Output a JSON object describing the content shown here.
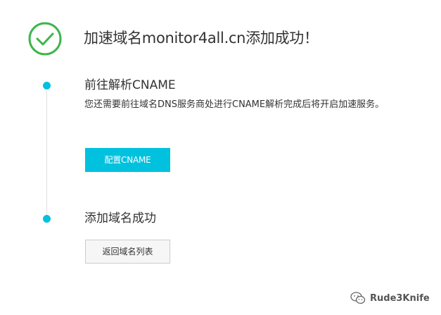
{
  "header": {
    "title": "加速域名monitor4all.cn添加成功！",
    "status_icon": "check-circle-icon",
    "status_color": "#3cb64a"
  },
  "steps": [
    {
      "title": "前往解析CNAME",
      "description": "您还需要前往域名DNS服务商处进行CNAME解析完成后将开启加速服务。",
      "button_label": "配置CNAME"
    },
    {
      "title": "添加域名成功",
      "button_label": "返回域名列表"
    }
  ],
  "colors": {
    "accent": "#00c1de",
    "timeline": "#e0e0e0"
  },
  "watermark": {
    "icon": "wechat-icon",
    "text": "Rude3Knife"
  }
}
